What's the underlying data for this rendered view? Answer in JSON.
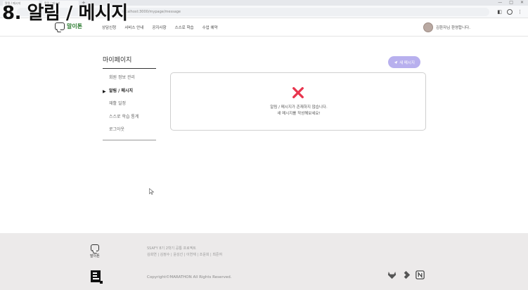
{
  "video_title": "8. 알림 / 메시지",
  "browser": {
    "tabs": [
      "알림 / 메시지",
      "알림 / 메시지"
    ],
    "new_tab": "+",
    "window_controls": [
      "—",
      "□",
      "✕"
    ],
    "url": "localhost:3000/mypage/message"
  },
  "header": {
    "logo_text": "말이톤",
    "nav": [
      "상담신청",
      "서비스 안내",
      "공지사항",
      "스스로 학습",
      "수업 예약"
    ],
    "user_greeting": "김환자님 환영합니다."
  },
  "sidebar": {
    "title": "마이페이지",
    "active_marker": "▶",
    "items": [
      "회원 정보 관리",
      "알림 / 메시지",
      "재활 일정",
      "스스로 학습 통계",
      "로그아웃"
    ]
  },
  "main": {
    "new_message_button": "새 메시지",
    "empty_line1": "알림 / 메시지가 존재하지 않습니다.",
    "empty_line2": "새 메시지를 작성해보세요!"
  },
  "footer": {
    "logo_text": "말이톤",
    "team": "SSAFY 8기 2학기 공통 프로젝트",
    "members": "김희연 | 김정수 | 윤성선 | 이연재 | 조윤희 | 최준여",
    "copyright": "Copyright©MARATHON All Rights Reserved."
  },
  "icons": {
    "empty_icon": "x-mark",
    "footer": [
      "gitlab-icon",
      "jira-icon",
      "notion-icon"
    ]
  },
  "colors": {
    "accent_button": "#b8b0ee",
    "x_mark": "#e8354e",
    "logo_green": "#2e7d32",
    "footer_bg": "#eceaea"
  }
}
